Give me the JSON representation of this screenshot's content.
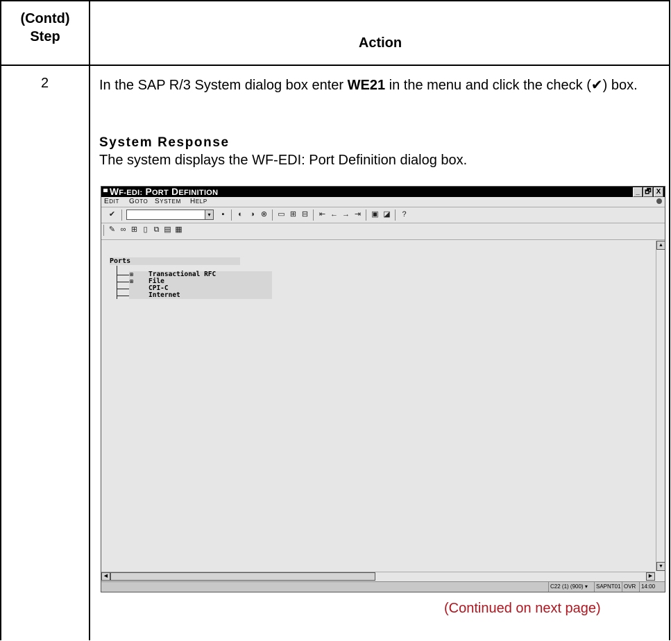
{
  "table": {
    "header_step": "(Contd)\nStep",
    "header_action": "Action",
    "step_number": "2",
    "instruction_pre": "In the SAP R/3 System dialog box enter ",
    "instruction_code": "WE21",
    "instruction_post": " in the menu and click the check (✔) box.",
    "system_response_title": "System Response",
    "system_response_text": "The system displays the WF-EDI: Port Definition dialog box.",
    "continued_text": "(Continued on next page)"
  },
  "colors": {
    "continued": "#b0161f",
    "titlebar": "#000000",
    "window_bg": "#e6e6e6"
  },
  "sap_window": {
    "title": "WF-EDI: Port Definition",
    "window_controls": [
      "_",
      "🗗",
      "X"
    ],
    "menu": [
      "Edit",
      "Goto",
      "System",
      "Help"
    ],
    "command_field_value": "",
    "toolbar_icons": [
      "enter-icon",
      "save-icon",
      "back-icon",
      "exit-icon",
      "cancel-icon",
      "print-icon",
      "find-icon",
      "find-next-icon",
      "first-page-icon",
      "prev-page-icon",
      "next-page-icon",
      "last-page-icon",
      "create-session-icon",
      "shortcut-icon",
      "help-icon"
    ],
    "app_toolbar_icons": [
      "change-icon",
      "display-icon",
      "find-icon",
      "delete-icon",
      "copy-icon",
      "save-layout-icon",
      "expand-icon"
    ],
    "tree": {
      "root": "Ports",
      "nodes": [
        {
          "label": "Transactional RFC",
          "expandable": true
        },
        {
          "label": "File",
          "expandable": true
        },
        {
          "label": "CPI-C",
          "expandable": false
        },
        {
          "label": "Internet",
          "expandable": false
        }
      ]
    },
    "status": {
      "system": "C22 (1) (900)",
      "server": "SAPNT01",
      "mode": "OVR",
      "time": "14:00"
    }
  }
}
